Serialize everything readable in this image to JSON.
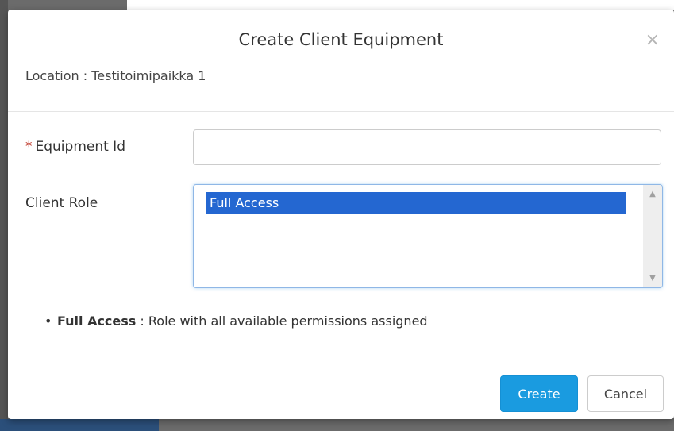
{
  "modal": {
    "title": "Create Client Equipment",
    "close_glyph": "×",
    "location": "Location : Testitoimipaikka 1"
  },
  "form": {
    "equipment_id": {
      "required_mark": "*",
      "label": "Equipment Id",
      "value": ""
    },
    "client_role": {
      "label": "Client Role",
      "options": [
        "Full Access"
      ],
      "selected": "Full Access"
    }
  },
  "role_description": {
    "name": "Full Access",
    "text": " : Role with all available permissions assigned"
  },
  "footer": {
    "create_label": "Create",
    "cancel_label": "Cancel"
  },
  "colors": {
    "primary": "#1a9be0",
    "selection": "#2467d1",
    "required": "#c0392b"
  }
}
